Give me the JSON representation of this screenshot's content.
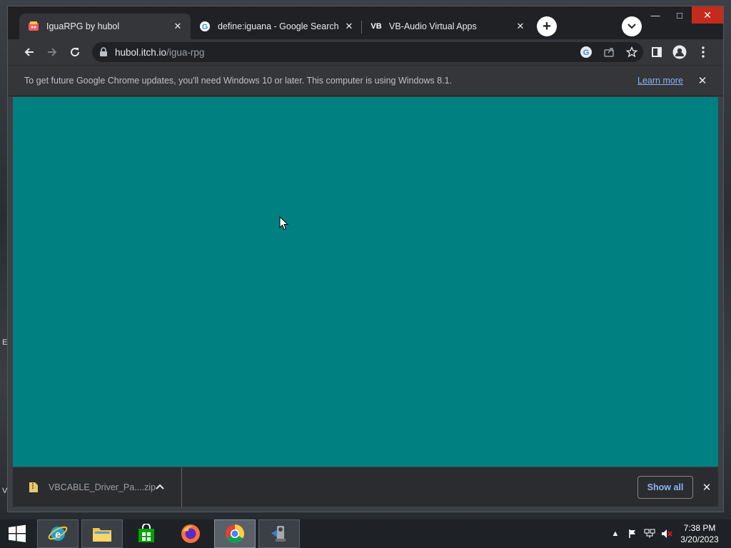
{
  "browser": {
    "tabs": [
      {
        "title": "IguaRPG by hubol",
        "active": true,
        "favicon": "itch-icon"
      },
      {
        "title": "define:iguana - Google Search",
        "active": false,
        "favicon": "google-icon"
      },
      {
        "title": "VB-Audio Virtual Apps",
        "active": false,
        "favicon": "vb-icon",
        "favicon_text": "VB"
      }
    ],
    "address": {
      "host": "hubol.itch.io",
      "path": "/igua-rpg"
    },
    "infobar": {
      "message": "To get future Google Chrome updates, you'll need Windows 10 or later. This computer is using Windows 8.1.",
      "link": "Learn more"
    },
    "content_color": "#008080",
    "downloads": {
      "file_name": "VBCABLE_Driver_Pa....zip",
      "show_all_label": "Show all"
    }
  },
  "taskbar": {
    "apps": [
      "windows-start-icon",
      "internet-explorer-icon",
      "file-explorer-icon",
      "store-icon",
      "firefox-icon",
      "chrome-icon",
      "app-icon"
    ],
    "clock": {
      "time": "7:38 PM",
      "date": "3/20/2023"
    }
  },
  "desktop": {
    "edge_glyphs": [
      "E",
      "V"
    ]
  }
}
